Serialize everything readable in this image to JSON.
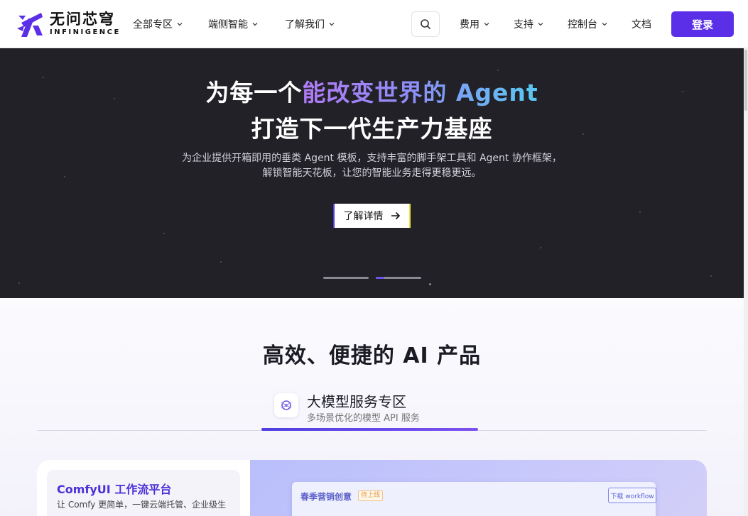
{
  "header": {
    "logo": {
      "cn": "无问芯穹",
      "en": "INFINIGENCE"
    },
    "nav": [
      {
        "label": "全部专区"
      },
      {
        "label": "端侧智能"
      },
      {
        "label": "了解我们"
      }
    ],
    "right_nav": [
      {
        "label": "费用"
      },
      {
        "label": "支持"
      },
      {
        "label": "控制台"
      },
      {
        "label": "文档"
      }
    ],
    "login_label": "登录",
    "brand_color": "#5b2fe8"
  },
  "hero": {
    "title_prefix": "为每一个",
    "title_highlight": "能改变世界的 Agent",
    "title_line2": "打造下一代生产力基座",
    "desc_line1": "为企业提供开箱即用的垂类 Agent 模板，支持丰富的脚手架工具和 Agent 协作框架，",
    "desc_line2": "解锁智能天花板，让您的智能业务走得更稳更远。",
    "cta_label": "了解详情",
    "slides": 2,
    "active_slide": 2,
    "background": "#232128"
  },
  "products": {
    "title": "高效、便捷的 AI 产品",
    "tabs": [
      {
        "title": "大模型服务专区",
        "subtitle": "多场景优化的模型 API 服务",
        "active": true
      }
    ],
    "card": {
      "title": "ComfyUI 工作流平台",
      "desc": "让 Comfy 更简单，一键云端托管、企业级生",
      "preview_title": "春季营销创意",
      "preview_badge": "待上线",
      "preview_button": "下载 workflow"
    }
  }
}
